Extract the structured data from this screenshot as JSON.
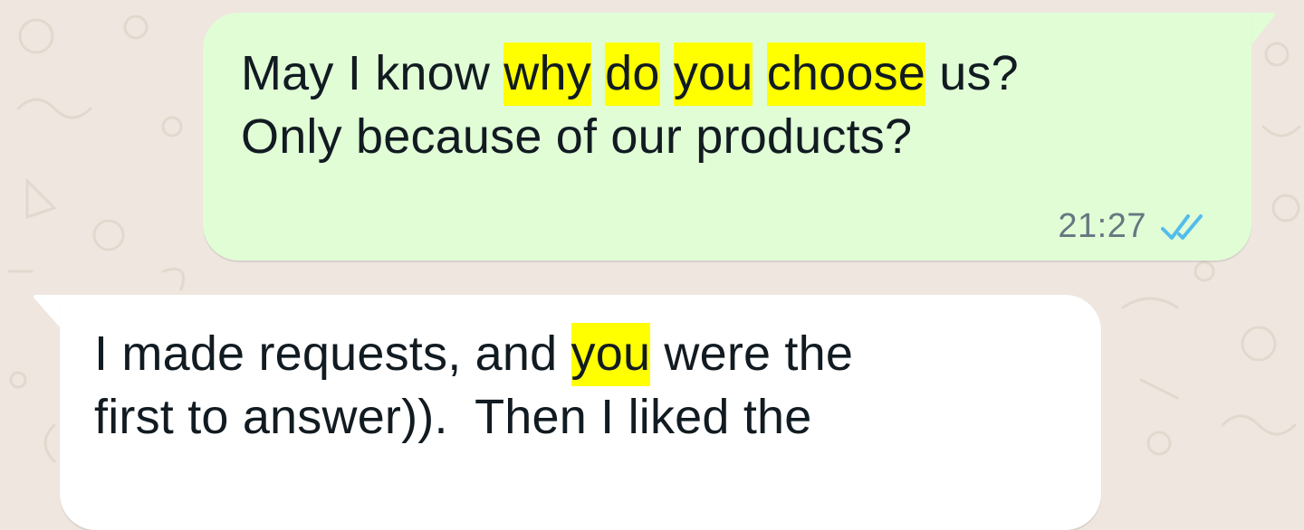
{
  "chat": {
    "wallpaper_color": "#efe7df",
    "messages": [
      {
        "direction": "outgoing",
        "bubble_color": "#e1fdd6",
        "line1": {
          "pre": "May I know ",
          "hl1": "why",
          "sep1": " ",
          "hl2": "do",
          "sep2": " ",
          "hl3": "you",
          "sep3": " ",
          "hl4": "choose",
          "post": " us?"
        },
        "line2": "Only because of our products?",
        "time": "21:27",
        "status_icon": "double-check-read-icon",
        "status_color": "#53bdeb"
      },
      {
        "direction": "incoming",
        "bubble_color": "#ffffff",
        "line1": {
          "pre": "I made requests, and ",
          "hl1": "you",
          "post": " were the"
        },
        "line2": "first to answer)).  Then I liked the"
      }
    ],
    "highlight_color": "#ffff00"
  }
}
